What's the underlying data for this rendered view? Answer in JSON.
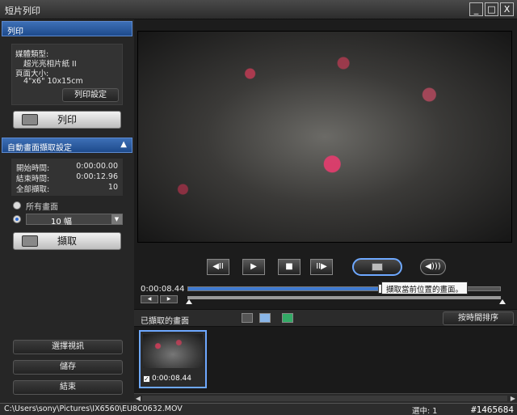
{
  "window": {
    "title": "短片列印",
    "buttons": [
      "_",
      "□",
      "X"
    ]
  },
  "print_section": {
    "header": "列印",
    "media_type_label": "媒體類型:",
    "media_type_value": "超光亮相片紙 II",
    "page_size_label": "頁面大小:",
    "page_size_value": "4\"x6\" 10x15cm",
    "print_settings_button": "列印設定",
    "print_button": "列印"
  },
  "capture_section": {
    "header": "自動畫面擷取設定",
    "header_icon": "collapse-up-icon",
    "start_time_label": "開始時間:",
    "start_time_value": "0:00:00.00",
    "end_time_label": "結束時間:",
    "end_time_value": "0:00:12.96",
    "total_capture_label": "全部擷取:",
    "total_capture_value": "10",
    "all_frames_label": "所有畫面",
    "frame_count_value": "10",
    "frame_unit": "幅",
    "capture_button": "擷取"
  },
  "bottom_buttons": {
    "select_video": "選擇視訊",
    "save": "儲存",
    "finish": "結束"
  },
  "player": {
    "buttons": [
      "◀II",
      "▶",
      "■",
      "II▶"
    ],
    "time": "0:00:08.44",
    "progress": 0.62,
    "tooltip": "擷取當前位置的畫面。",
    "volume_icon": "volume-icon",
    "capture_icon": "camera-capture-icon"
  },
  "captured": {
    "label": "已擷取的畫面",
    "sort_button": "按時間排序",
    "toolbar_icons": [
      "grid-small-icon",
      "grid-large-icon",
      "edit-icon"
    ],
    "thumbnails": [
      {
        "time": "0:00:08.44",
        "checked": true
      }
    ]
  },
  "statusbar": {
    "path": "C:\\Users\\sony\\Pictures\\IX6560\\EU8C0632.MOV",
    "selected": "選中: 1",
    "watermark": "#1465684"
  },
  "colors": {
    "accent": "#3f7ad0",
    "header_blue": "#1e4b8c",
    "rose": "#e0356a"
  }
}
